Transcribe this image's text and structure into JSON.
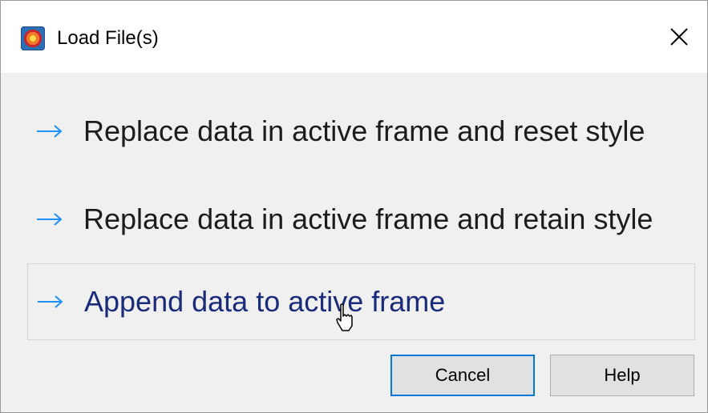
{
  "window": {
    "title": "Load File(s)",
    "icon": "tecplot-app-icon",
    "close_icon": "close-icon"
  },
  "options": [
    {
      "label": "Replace data in active frame and reset style",
      "icon": "arrow-right-icon"
    },
    {
      "label": "Replace data in active frame and retain style",
      "icon": "arrow-right-icon"
    },
    {
      "label": "Append data to active frame",
      "icon": "arrow-right-icon",
      "state": "hovered"
    }
  ],
  "buttons": {
    "cancel": "Cancel",
    "help": "Help"
  },
  "colors": {
    "arrow": "#1e90ff",
    "focus_border": "#0078d7",
    "hover_text": "#1a2b7a"
  }
}
